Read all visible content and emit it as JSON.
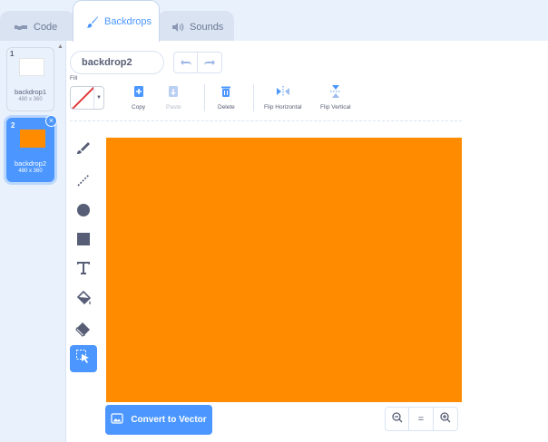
{
  "tabs": [
    {
      "label": "Code",
      "icon": "code-icon"
    },
    {
      "label": "Backdrops",
      "icon": "paintbrush-icon",
      "active": true
    },
    {
      "label": "Sounds",
      "icon": "speaker-icon"
    }
  ],
  "backdrops": [
    {
      "number": "1",
      "name": "backdrop1",
      "size": "480 x 360"
    },
    {
      "number": "2",
      "name": "backdrop2",
      "size": "480 x 360",
      "selected": true
    }
  ],
  "editor": {
    "costume_name": "backdrop2",
    "fill_label": "Fill",
    "actions": {
      "copy": "Copy",
      "paste": "Paste",
      "delete": "Delete",
      "flip_horizontal": "Flip Horizontal",
      "flip_vertical": "Flip Vertical"
    },
    "tools": [
      "brush-icon",
      "line-icon",
      "circle-icon",
      "rectangle-icon",
      "text-icon",
      "fill-bucket-icon",
      "eraser-icon",
      "select-icon"
    ],
    "selected_tool": "select-icon",
    "canvas_color": "#ff8c00",
    "convert_label": "Convert to Vector",
    "zoom": {
      "out": "zoom-out-icon",
      "reset": "=",
      "in": "zoom-in-icon"
    }
  },
  "colors": {
    "accent": "#4c97ff",
    "canvas": "#ff8c00",
    "background": "#e9f1fc"
  }
}
